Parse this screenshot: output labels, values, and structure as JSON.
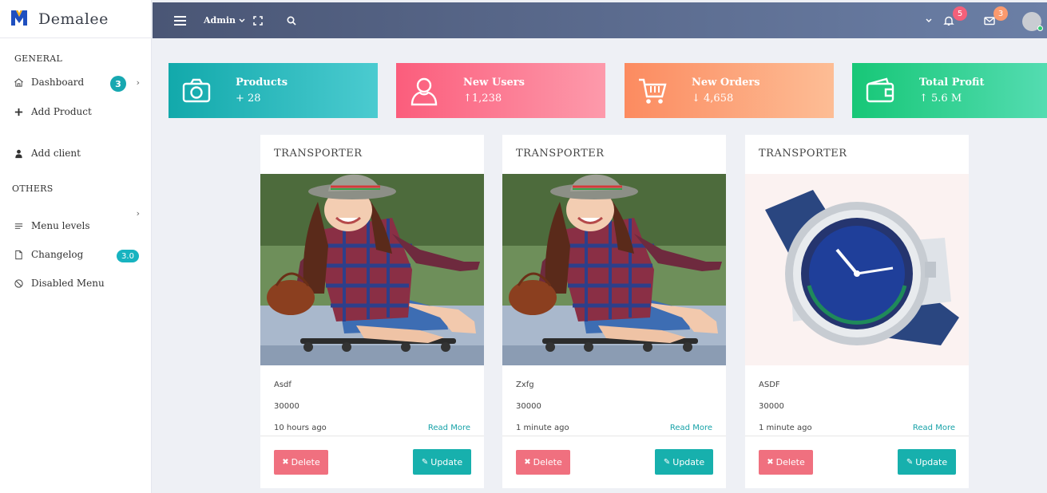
{
  "brand": {
    "name": "Demalee",
    "logo_colors": [
      "#1f4fbf",
      "#f6b21b"
    ]
  },
  "sidebar": {
    "sections": [
      {
        "title": "GENERAL"
      },
      {
        "title": "OTHERS"
      }
    ],
    "items": [
      {
        "label": "Dashboard",
        "icon": "home-icon",
        "badge": "3",
        "has_submenu": true
      },
      {
        "label": "Add Product",
        "icon": "plus-icon"
      },
      {
        "label": "Add client",
        "icon": "user-icon"
      },
      {
        "label": "Menu levels",
        "icon": "lines-icon",
        "has_submenu": true
      },
      {
        "label": "Changelog",
        "icon": "file-icon",
        "badge": "3.0"
      },
      {
        "label": "Disabled Menu",
        "icon": "ban-icon"
      }
    ]
  },
  "topbar": {
    "user_menu_label": "Admin",
    "notifications_count": "5",
    "messages_count": "3",
    "gradient": [
      "#4a5675",
      "#6b7fa6"
    ]
  },
  "stats": [
    {
      "title": "Products",
      "value": "+ 28",
      "icon": "camera-icon",
      "gradient": [
        "#12a9ab",
        "#4bcbd0"
      ]
    },
    {
      "title": "New Users",
      "value": "↑1,238",
      "icon": "user-icon",
      "gradient": [
        "#fb5d7c",
        "#fd9aab"
      ]
    },
    {
      "title": "New Orders",
      "value": "↓ 4,658",
      "icon": "cart-icon",
      "gradient": [
        "#fc8b60",
        "#fdbd95"
      ]
    },
    {
      "title": "Total Profit",
      "value": "↑ 5.6 M",
      "icon": "wallet-icon",
      "gradient": [
        "#17c777",
        "#54dcb1"
      ]
    }
  ],
  "products": [
    {
      "category": "TRANSPORTER",
      "name": "Asdf",
      "price": "30000",
      "time": "10 hours ago",
      "image": "girl-skateboard-photo"
    },
    {
      "category": "TRANSPORTER",
      "name": "Zxfg",
      "price": "30000",
      "time": "1 minute ago",
      "image": "girl-skateboard-photo"
    },
    {
      "category": "TRANSPORTER",
      "name": "ASDF",
      "price": "30000",
      "time": "1 minute ago",
      "image": "wristwatch-photo"
    }
  ],
  "card_actions": {
    "read_more": "Read More",
    "delete": "Delete",
    "update": "Update"
  }
}
